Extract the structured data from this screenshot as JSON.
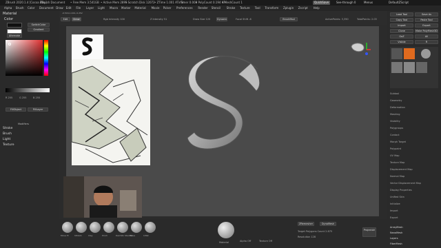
{
  "title_bar": {
    "app": "ZBrush 2020.1.4 [Cocoa Play]",
    "document": "ZBrush Document",
    "free_mem": "• Free Mem 3.541GB",
    "active_mem": "• Active Mem 2895",
    "scratch_disk": "• Scratch Disk 12072",
    "ztime": "• ZTime 1.001 ATime",
    "timer": "Timer 0.008",
    "poly_count": "• PolyCount 0.194 KP",
    "mesh_count": "• MeshCount 1",
    "quicksave": "QuickSave",
    "seethrough": "See-through 0",
    "menus": "Menus",
    "default_zscript": "DefaultZScript"
  },
  "menu_bar": [
    "Alpha",
    "Brush",
    "Color",
    "Document",
    "Draw",
    "Edit",
    "File",
    "Layer",
    "Light",
    "Macro",
    "Marker",
    "Material",
    "Movie",
    "Picker",
    "Preferences",
    "Render",
    "Stencil",
    "Stroke",
    "Texture",
    "Tool",
    "Transform",
    "Zplugin",
    "Zscript",
    "Help"
  ],
  "left_panel": {
    "material_header": "Material",
    "color_header": "Color",
    "switch_color": "SwitchColor",
    "gradient": "Gradient",
    "alternate": "Alternate",
    "r_val": "R 255",
    "g_val": "G 255",
    "b_val": "B 255",
    "fill_object": "FillObject",
    "fill_layer": "FillLayer",
    "modifiers": "Modifiers",
    "sections": [
      "Stroke",
      "Brush",
      "Light",
      "Texture"
    ]
  },
  "toolbar": {
    "coords": "-0.516,1.224,-0.252",
    "edit": "Edit",
    "draw": "Draw",
    "rgb_intensity": "Rgb Intensity 100",
    "z_intensity": "Z Intensity 51",
    "draw_size": "Draw Size 120",
    "dynamic": "Dynamic",
    "focal_shift": "Focal Shift -6",
    "brush_mod": "BrushMod",
    "active_points": "ActivePoints: 3,350",
    "total_points": "TotalPoints: 2.03"
  },
  "bottom_bar": {
    "brushes": [
      "Move Tc",
      "hPolish",
      "Clay",
      "Pinch",
      "DamStn Standar",
      "Move",
      "Inflat"
    ],
    "dynamesh": "DynaMesh",
    "zremesher": "ZRemesher",
    "target_polygons": "Target Polygons Count 2.875",
    "resolution": "Resolution 128",
    "project_all": "ProjectAll",
    "grid_label": "Grid Divide",
    "alpha_off": "Alpha Off",
    "texture_off": "Texture Off",
    "material_label": "Material"
  },
  "right_panel": {
    "tool_buttons": [
      "Load Tool",
      "Save As",
      "Copy Tool",
      "Paste Tool",
      "Import",
      "Export",
      "Clone",
      "Make PolyMesh3D",
      "GoZ",
      "All",
      "Visible",
      "R"
    ],
    "subtool_label": "Subtool",
    "items": [
      "pm3d_tube1hl_21_48",
      "Simple Brush",
      "Cylinder PolyMesh3D",
      "TPoseJ",
      "Sphere3D",
      "TPose3_A",
      "TPose_4"
    ],
    "sections": [
      "Geometry",
      "Deformation",
      "Masking",
      "Visibility",
      "Polygroups",
      "Contact",
      "Morph Target",
      "Polypaint",
      "UV Map",
      "Texture Map",
      "Displacement Map",
      "Normal Map",
      "Vector Displacement Map",
      "Display Properties",
      "Unified Skin",
      "Initialize",
      "Import",
      "Export"
    ],
    "bottom_items": [
      "ArrayMesh",
      "NanoMesh",
      "Layers",
      "FiberMesh"
    ]
  },
  "colors": {
    "accent": "#e06a1e",
    "canvas_bg": "#4a4a4a",
    "panel_bg": "#2a2a2a"
  }
}
